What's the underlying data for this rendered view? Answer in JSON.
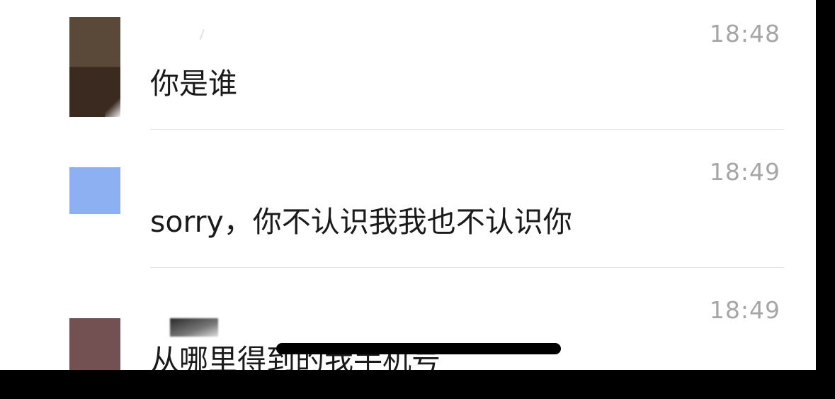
{
  "messages": [
    {
      "time": "18:48",
      "text": "你是谁"
    },
    {
      "time": "18:49",
      "text": "sorry，你不认识我我也不认识你"
    },
    {
      "time": "18:49",
      "text": "从哪里得到的我手机号"
    }
  ],
  "colors": {
    "background": "#ffffff",
    "time_text": "#a6a6a6",
    "message_text": "#1a1a1a",
    "divider": "#e4e4e4",
    "avatar_1": "#4a3a2e",
    "avatar_2": "#8cb0f2",
    "avatar_3": "#735052"
  },
  "icons": {
    "avatars": [
      "avatar",
      "avatar",
      "avatar"
    ],
    "home_indicator": "home-indicator"
  }
}
